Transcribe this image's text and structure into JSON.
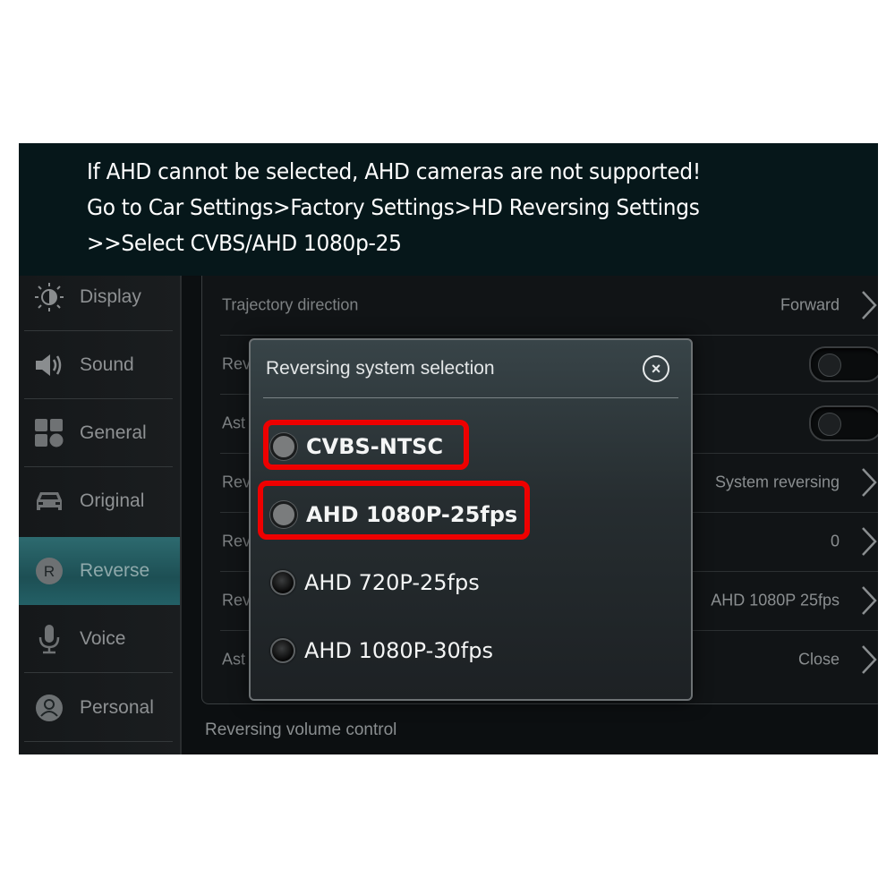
{
  "banner": {
    "line1": "If AHD cannot be selected, AHD cameras are not supported!",
    "line2": "Go to Car Settings>Factory Settings>HD Reversing Settings",
    "line3": ">>Select CVBS/AHD 1080p-25"
  },
  "sidebar": {
    "items": [
      {
        "label": "Display",
        "icon": "brightness-icon"
      },
      {
        "label": "Sound",
        "icon": "speaker-icon"
      },
      {
        "label": "General",
        "icon": "grid-icon"
      },
      {
        "label": "Original",
        "icon": "car-icon"
      },
      {
        "label": "Reverse",
        "icon": "reverse-r-icon",
        "active": true
      },
      {
        "label": "Voice",
        "icon": "microphone-icon"
      },
      {
        "label": "Personal",
        "icon": "user-icon"
      }
    ]
  },
  "settings": {
    "rows": [
      {
        "label": "Trajectory direction",
        "value": "Forward",
        "control": "chevron"
      },
      {
        "label": "Rev",
        "value": "",
        "control": "toggle",
        "state": "off"
      },
      {
        "label": "Ast",
        "value": "",
        "control": "toggle",
        "state": "off"
      },
      {
        "label": "Rev",
        "value": "System reversing",
        "control": "chevron"
      },
      {
        "label": "Rev",
        "value": "0",
        "control": "chevron"
      },
      {
        "label": "Rev",
        "value": "AHD 1080P 25fps",
        "control": "chevron"
      },
      {
        "label": "Ast",
        "value": "Close",
        "control": "chevron"
      }
    ],
    "footer_label": "Reversing volume control"
  },
  "dialog": {
    "title": "Reversing system selection",
    "close_icon": "close-circle-icon",
    "options": [
      {
        "label": "CVBS-NTSC",
        "highlighted": true
      },
      {
        "label": "AHD 1080P-25fps",
        "highlighted": true
      },
      {
        "label": "AHD 720P-25fps",
        "highlighted": false
      },
      {
        "label": "AHD 1080P-30fps",
        "highlighted": false
      }
    ]
  },
  "colors": {
    "highlight": "#ee0000",
    "active_tab": "#236066",
    "banner_bg": "#06171a"
  }
}
